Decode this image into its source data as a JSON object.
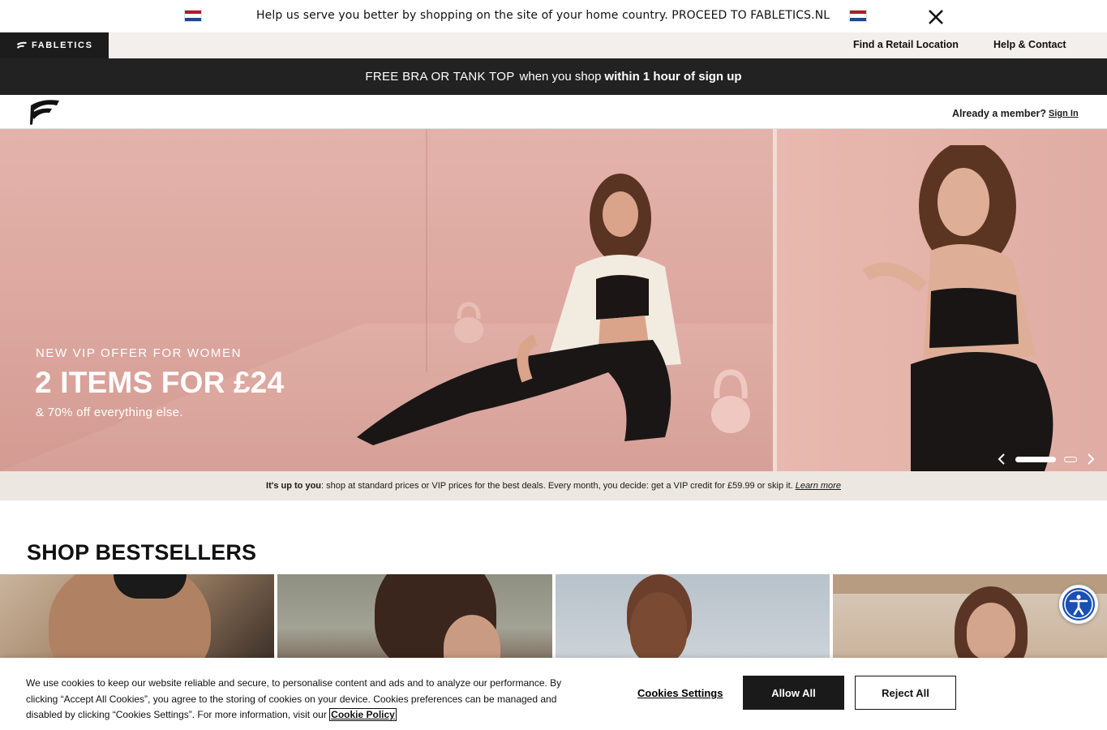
{
  "country_banner": {
    "message": "Help us serve you better by shopping on the site of your home country. PROCEED TO FABLETICS.NL",
    "flag_icon": "netherlands-flag-icon",
    "flag_colors": [
      "#ae1c28",
      "#ffffff",
      "#21468b"
    ],
    "close_icon": "close-icon"
  },
  "utility_bar": {
    "brand": "FABLETICS",
    "links": [
      "Find a Retail Location",
      "Help & Contact"
    ]
  },
  "promo": {
    "part1": "FREE BRA OR TANK TOP",
    "part2": "when you shop",
    "part3": "within 1 hour of sign up"
  },
  "nav": {
    "logo_icon": "fabletics-f-logo-icon",
    "member_question": "Already a member?",
    "sign_in": "Sign In"
  },
  "hero": {
    "eyebrow": "NEW VIP OFFER FOR WOMEN",
    "headline": "2 ITEMS FOR £24",
    "subline": "& 70% off everything else.",
    "carousel": {
      "slides": 2,
      "active": 1
    }
  },
  "vip_strip": {
    "bold": "It's up to you",
    "text": ": shop at standard prices or VIP prices for the best deals. Every month, you decide: get a VIP credit for £59.99 or skip it.",
    "link": "Learn more"
  },
  "bestsellers": {
    "title": "SHOP BESTSELLERS",
    "tile_count": 4
  },
  "accessibility": {
    "icon": "accessibility-person-icon"
  },
  "cookie": {
    "text": "We use cookies to keep our website reliable and secure, to personalise content and ads and to analyze our performance. By clicking “Accept All Cookies”, you agree to the storing of cookies on your device. Cookies preferences can be managed and disabled by clicking “Cookies Settings”. For more information, visit our",
    "policy_link": "Cookie Policy",
    "settings_button": "Cookies Settings",
    "allow_button": "Allow All",
    "reject_button": "Reject All"
  },
  "colors": {
    "dark": "#1c1c1c",
    "strip": "#ece7e1",
    "accent_blue": "#1a4fb5"
  }
}
